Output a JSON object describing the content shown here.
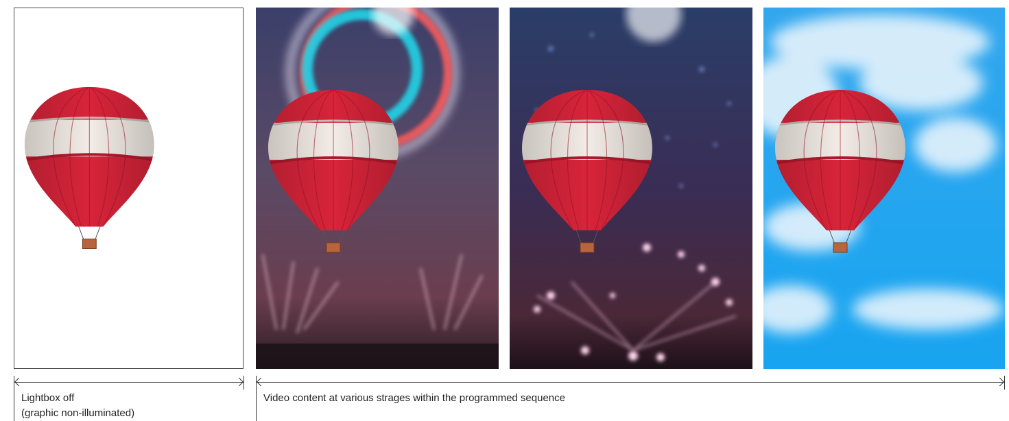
{
  "panels": [
    {
      "name": "lightbox-off-panel",
      "background": "white"
    },
    {
      "name": "video-frame-fireworks-ring",
      "background": "night-fireworks"
    },
    {
      "name": "video-frame-fireworks-burst",
      "background": "night-fireworks"
    },
    {
      "name": "video-frame-blue-sky",
      "background": "sky-clouds"
    }
  ],
  "captions": {
    "lightbox_off_line1": "Lightbox off",
    "lightbox_off_line2": "(graphic non-illuminated)",
    "video_content": "Video content at various strages within the programmed sequence"
  },
  "colors": {
    "balloon_red": "#d8243a",
    "balloon_white": "#f3ece6",
    "sky_blue": "#2aa8ee",
    "night_dark": "#2a2440"
  }
}
